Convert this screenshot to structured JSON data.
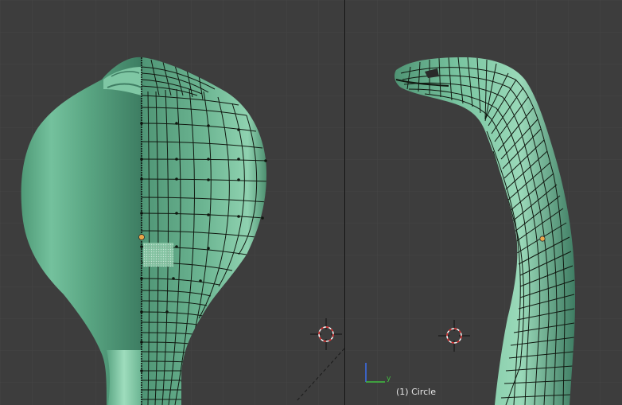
{
  "viewports": {
    "left": {
      "view": "front"
    },
    "right": {
      "view": "side",
      "object_label": "(1) Circle",
      "axis_labels": {
        "y": "y"
      }
    }
  },
  "colors": {
    "background": "#3d3d3d",
    "grid": "#454545",
    "mesh_fill": "#6fba97",
    "mesh_light": "#a6e3c3",
    "mesh_dark": "#3f7d63",
    "wire": "#101810",
    "vertex_orange": "#e8a64a",
    "cursor_red": "#d62020",
    "axis_z": "#3b6ff0",
    "axis_y": "#40c040"
  }
}
